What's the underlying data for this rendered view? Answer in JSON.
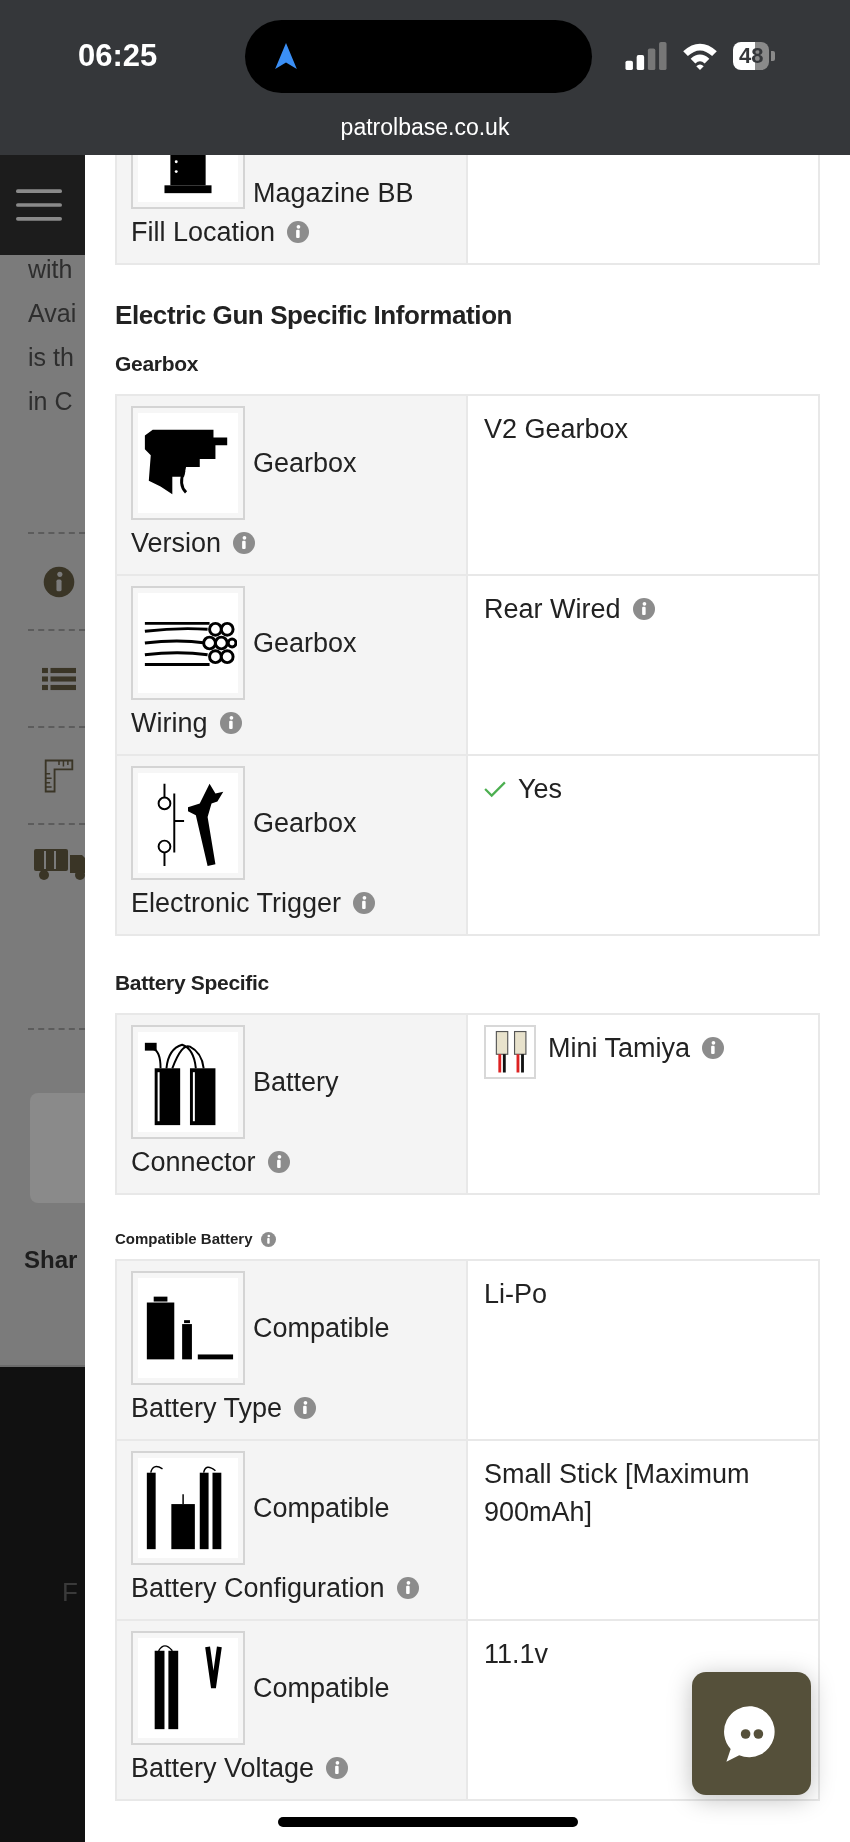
{
  "status_bar": {
    "time": "06:25",
    "battery": "48"
  },
  "address_bar": {
    "url": "patrolbase.co.uk"
  },
  "background_page": {
    "text_lines": [
      "with",
      "Avai",
      "is th",
      "in C"
    ],
    "share_heading": "Shar",
    "footer_text": "F"
  },
  "modal": {
    "blocks": [
      {
        "kind": "table",
        "rows": [
          {
            "kind": "magazine",
            "caption": "Magazine BB",
            "label": "Fill Location"
          }
        ]
      },
      {
        "kind": "title",
        "text": "Electric Gun Specific Information"
      },
      {
        "kind": "subtitle",
        "text": "Gearbox"
      },
      {
        "kind": "table",
        "rows": [
          {
            "kind": "gearbox",
            "caption": "Gearbox",
            "label": "Version",
            "value": "V2 Gearbox",
            "value_info": false,
            "checked": false
          },
          {
            "kind": "wiring",
            "caption": "Gearbox",
            "label": "Wiring",
            "value": "Rear Wired",
            "value_info": true,
            "checked": false
          },
          {
            "kind": "trigger",
            "caption": "Gearbox",
            "label": "Electronic Trigger",
            "value": "Yes",
            "value_info": false,
            "checked": true
          }
        ]
      },
      {
        "kind": "subtitle",
        "text": "Battery Specific"
      },
      {
        "kind": "table",
        "rows": [
          {
            "kind": "battery_connector",
            "caption": "Battery",
            "label": "Connector",
            "value": "Mini Tamiya",
            "value_image": true,
            "value_info": true
          }
        ]
      },
      {
        "kind": "small_subtitle",
        "text": "Compatible Battery"
      },
      {
        "kind": "table",
        "rows": [
          {
            "kind": "battery_type",
            "caption": "Compatible",
            "label": "Battery Type",
            "value": "Li-Po",
            "value_info": false
          },
          {
            "kind": "battery_config",
            "caption": "Compatible",
            "label": "Battery Configuration",
            "value": "Small Stick [Maximum 900mAh]",
            "value_info": false
          },
          {
            "kind": "battery_voltage",
            "caption": "Compatible",
            "label": "Battery Voltage",
            "value": "11.1v",
            "value_info": false
          }
        ]
      }
    ]
  }
}
